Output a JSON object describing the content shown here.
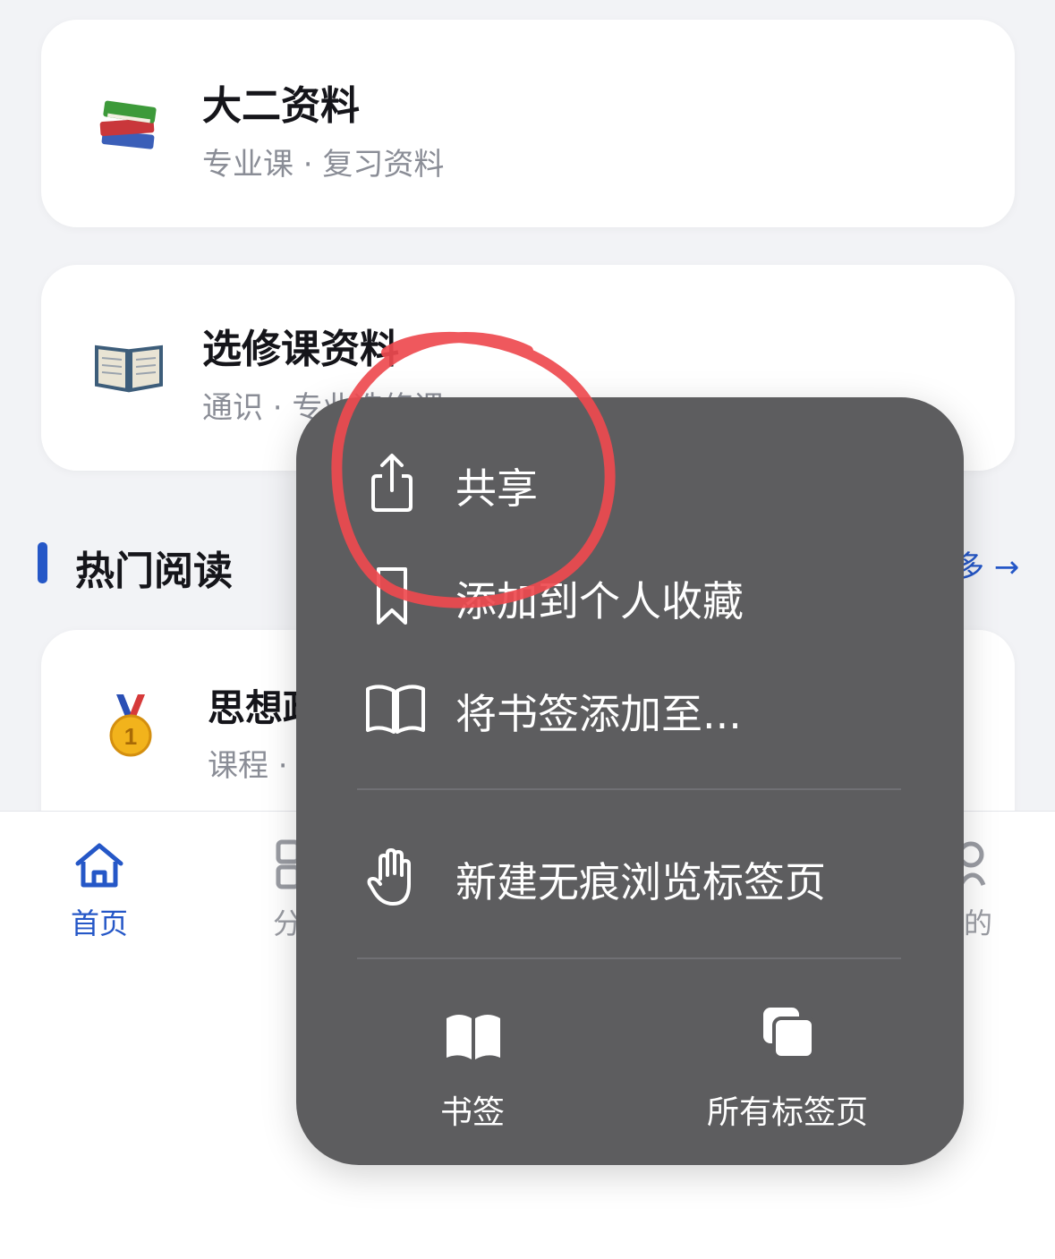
{
  "cards": [
    {
      "emoji": "📚",
      "title": "大二资料",
      "subtitle": "专业课 · 复习资料"
    },
    {
      "emoji": "📖",
      "title": "选修课资料",
      "subtitle": "通识 · 专业选修课"
    }
  ],
  "section": {
    "title": "热门阅读",
    "more_label": "多 →"
  },
  "hot_item": {
    "emoji": "🥇",
    "title": "思想政",
    "subtitle": "课程 ·"
  },
  "tabbar": {
    "tabs": [
      {
        "label": "首页",
        "icon": "home-icon",
        "active": true
      },
      {
        "label": "分",
        "icon": "grid-icon",
        "active": false
      },
      {
        "label": "的",
        "icon": "person-icon",
        "active": false
      }
    ],
    "active_color": "#2557c7",
    "inactive_color": "#9a9ca3"
  },
  "context_menu": {
    "items": [
      {
        "label": "共享",
        "icon": "share-icon"
      },
      {
        "label": "添加到个人收藏",
        "icon": "bookmark-icon"
      },
      {
        "label": "将书签添加至...",
        "icon": "book-open-icon"
      },
      {
        "label": "新建无痕浏览标签页",
        "icon": "hand-icon"
      }
    ],
    "bottom": [
      {
        "label": "书签",
        "icon": "book-filled-icon"
      },
      {
        "label": "所有标签页",
        "icon": "tabs-icon"
      }
    ],
    "background": "#5d5d5f"
  },
  "annotation": {
    "color": "#ee4a4f"
  }
}
